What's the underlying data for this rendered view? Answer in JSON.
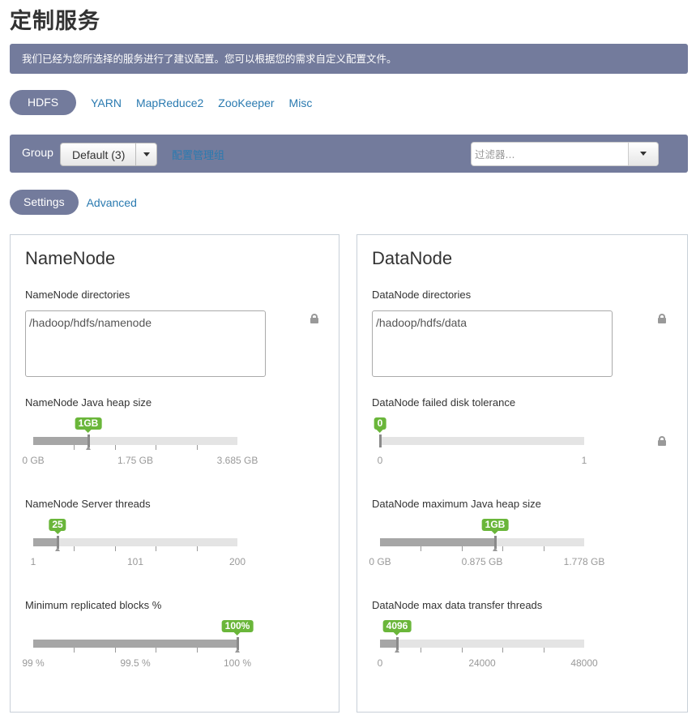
{
  "page_title": "定制服务",
  "info_message": "我们已经为您所选择的服务进行了建议配置。您可以根据您的需求自定义配置文件。",
  "service_tabs": {
    "active": "HDFS",
    "others": [
      "YARN",
      "MapReduce2",
      "ZooKeeper",
      "Misc"
    ]
  },
  "group_bar": {
    "label": "Group",
    "selected": "Default (3)",
    "manage_link": "配置管理组",
    "filter_placeholder": "过滤器..."
  },
  "settings_tabs": {
    "active": "Settings",
    "other": "Advanced"
  },
  "namenode": {
    "title": "NameNode",
    "directories_label": "NameNode directories",
    "directories_value": "/hadoop/hdfs/namenode",
    "heap": {
      "label": "NameNode Java heap size",
      "value_label": "1GB",
      "fraction": 0.271,
      "ticks": [
        "0 GB",
        "1.75 GB",
        "3.685 GB"
      ]
    },
    "threads": {
      "label": "NameNode Server threads",
      "value_label": "25",
      "fraction": 0.121,
      "ticks": [
        "1",
        "101",
        "200"
      ]
    },
    "replicated": {
      "label": "Minimum replicated blocks %",
      "value_label": "100%",
      "fraction": 1.0,
      "ticks": [
        "99 %",
        "99.5 %",
        "100 %"
      ]
    }
  },
  "datanode": {
    "title": "DataNode",
    "directories_label": "DataNode directories",
    "directories_value": "/hadoop/hdfs/data",
    "failed_disk": {
      "label": "DataNode failed disk tolerance",
      "value_label": "0",
      "fraction": 0.0,
      "ticks": [
        "0",
        "1"
      ]
    },
    "max_heap": {
      "label": "DataNode maximum Java heap size",
      "value_label": "1GB",
      "fraction": 0.563,
      "ticks": [
        "0 GB",
        "0.875 GB",
        "1.778 GB"
      ]
    },
    "transfer_threads": {
      "label": "DataNode max data transfer threads",
      "value_label": "4096",
      "fraction": 0.085,
      "ticks": [
        "0",
        "24000",
        "48000"
      ]
    }
  },
  "icons": {
    "lock": "lock-icon",
    "dropdown": "caret-down-icon"
  },
  "colors": {
    "bar_bg": "#737b9c",
    "link": "#2a7ab0",
    "badge": "#6ab63a"
  }
}
